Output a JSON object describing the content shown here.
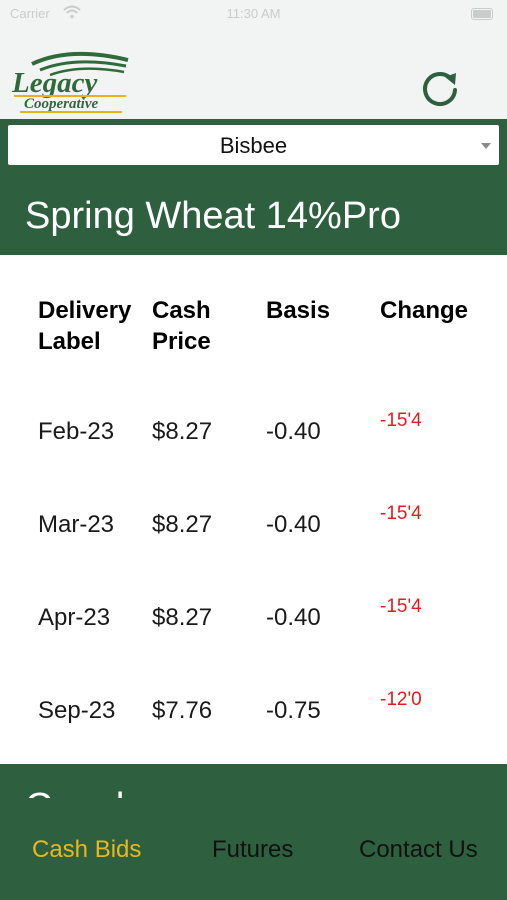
{
  "status": {
    "carrier": "Carrier",
    "time": "11:30 AM"
  },
  "header": {
    "logo_name": "Legacy",
    "logo_sub": "Cooperative",
    "refresh_icon": "refresh-icon"
  },
  "location": {
    "selected": "Bisbee"
  },
  "product": {
    "title": "Spring Wheat 14%Pro"
  },
  "table": {
    "headers": {
      "delivery_1": "Delivery",
      "delivery_2": "Label",
      "cash_1": "Cash",
      "cash_2": "Price",
      "basis": "Basis",
      "change": "Change"
    },
    "rows": [
      {
        "label": "Feb-23",
        "price": "$8.27",
        "basis": "-0.40",
        "change": "-15'4"
      },
      {
        "label": "Mar-23",
        "price": "$8.27",
        "basis": "-0.40",
        "change": "-15'4"
      },
      {
        "label": "Apr-23",
        "price": "$8.27",
        "basis": "-0.40",
        "change": "-15'4"
      },
      {
        "label": "Sep-23",
        "price": "$7.76",
        "basis": "-0.75",
        "change": "-12'0"
      }
    ]
  },
  "next_section": {
    "title": "Canola"
  },
  "tabs": [
    {
      "label": "Cash Bids",
      "active": true
    },
    {
      "label": "Futures",
      "active": false
    },
    {
      "label": "Contact Us",
      "active": false
    }
  ],
  "colors": {
    "brand_green": "#2e6040",
    "active_tab": "#e9b71e",
    "negative": "#e21c1c",
    "logo_green": "#2f6b3a",
    "logo_gold": "#e3b21c"
  }
}
